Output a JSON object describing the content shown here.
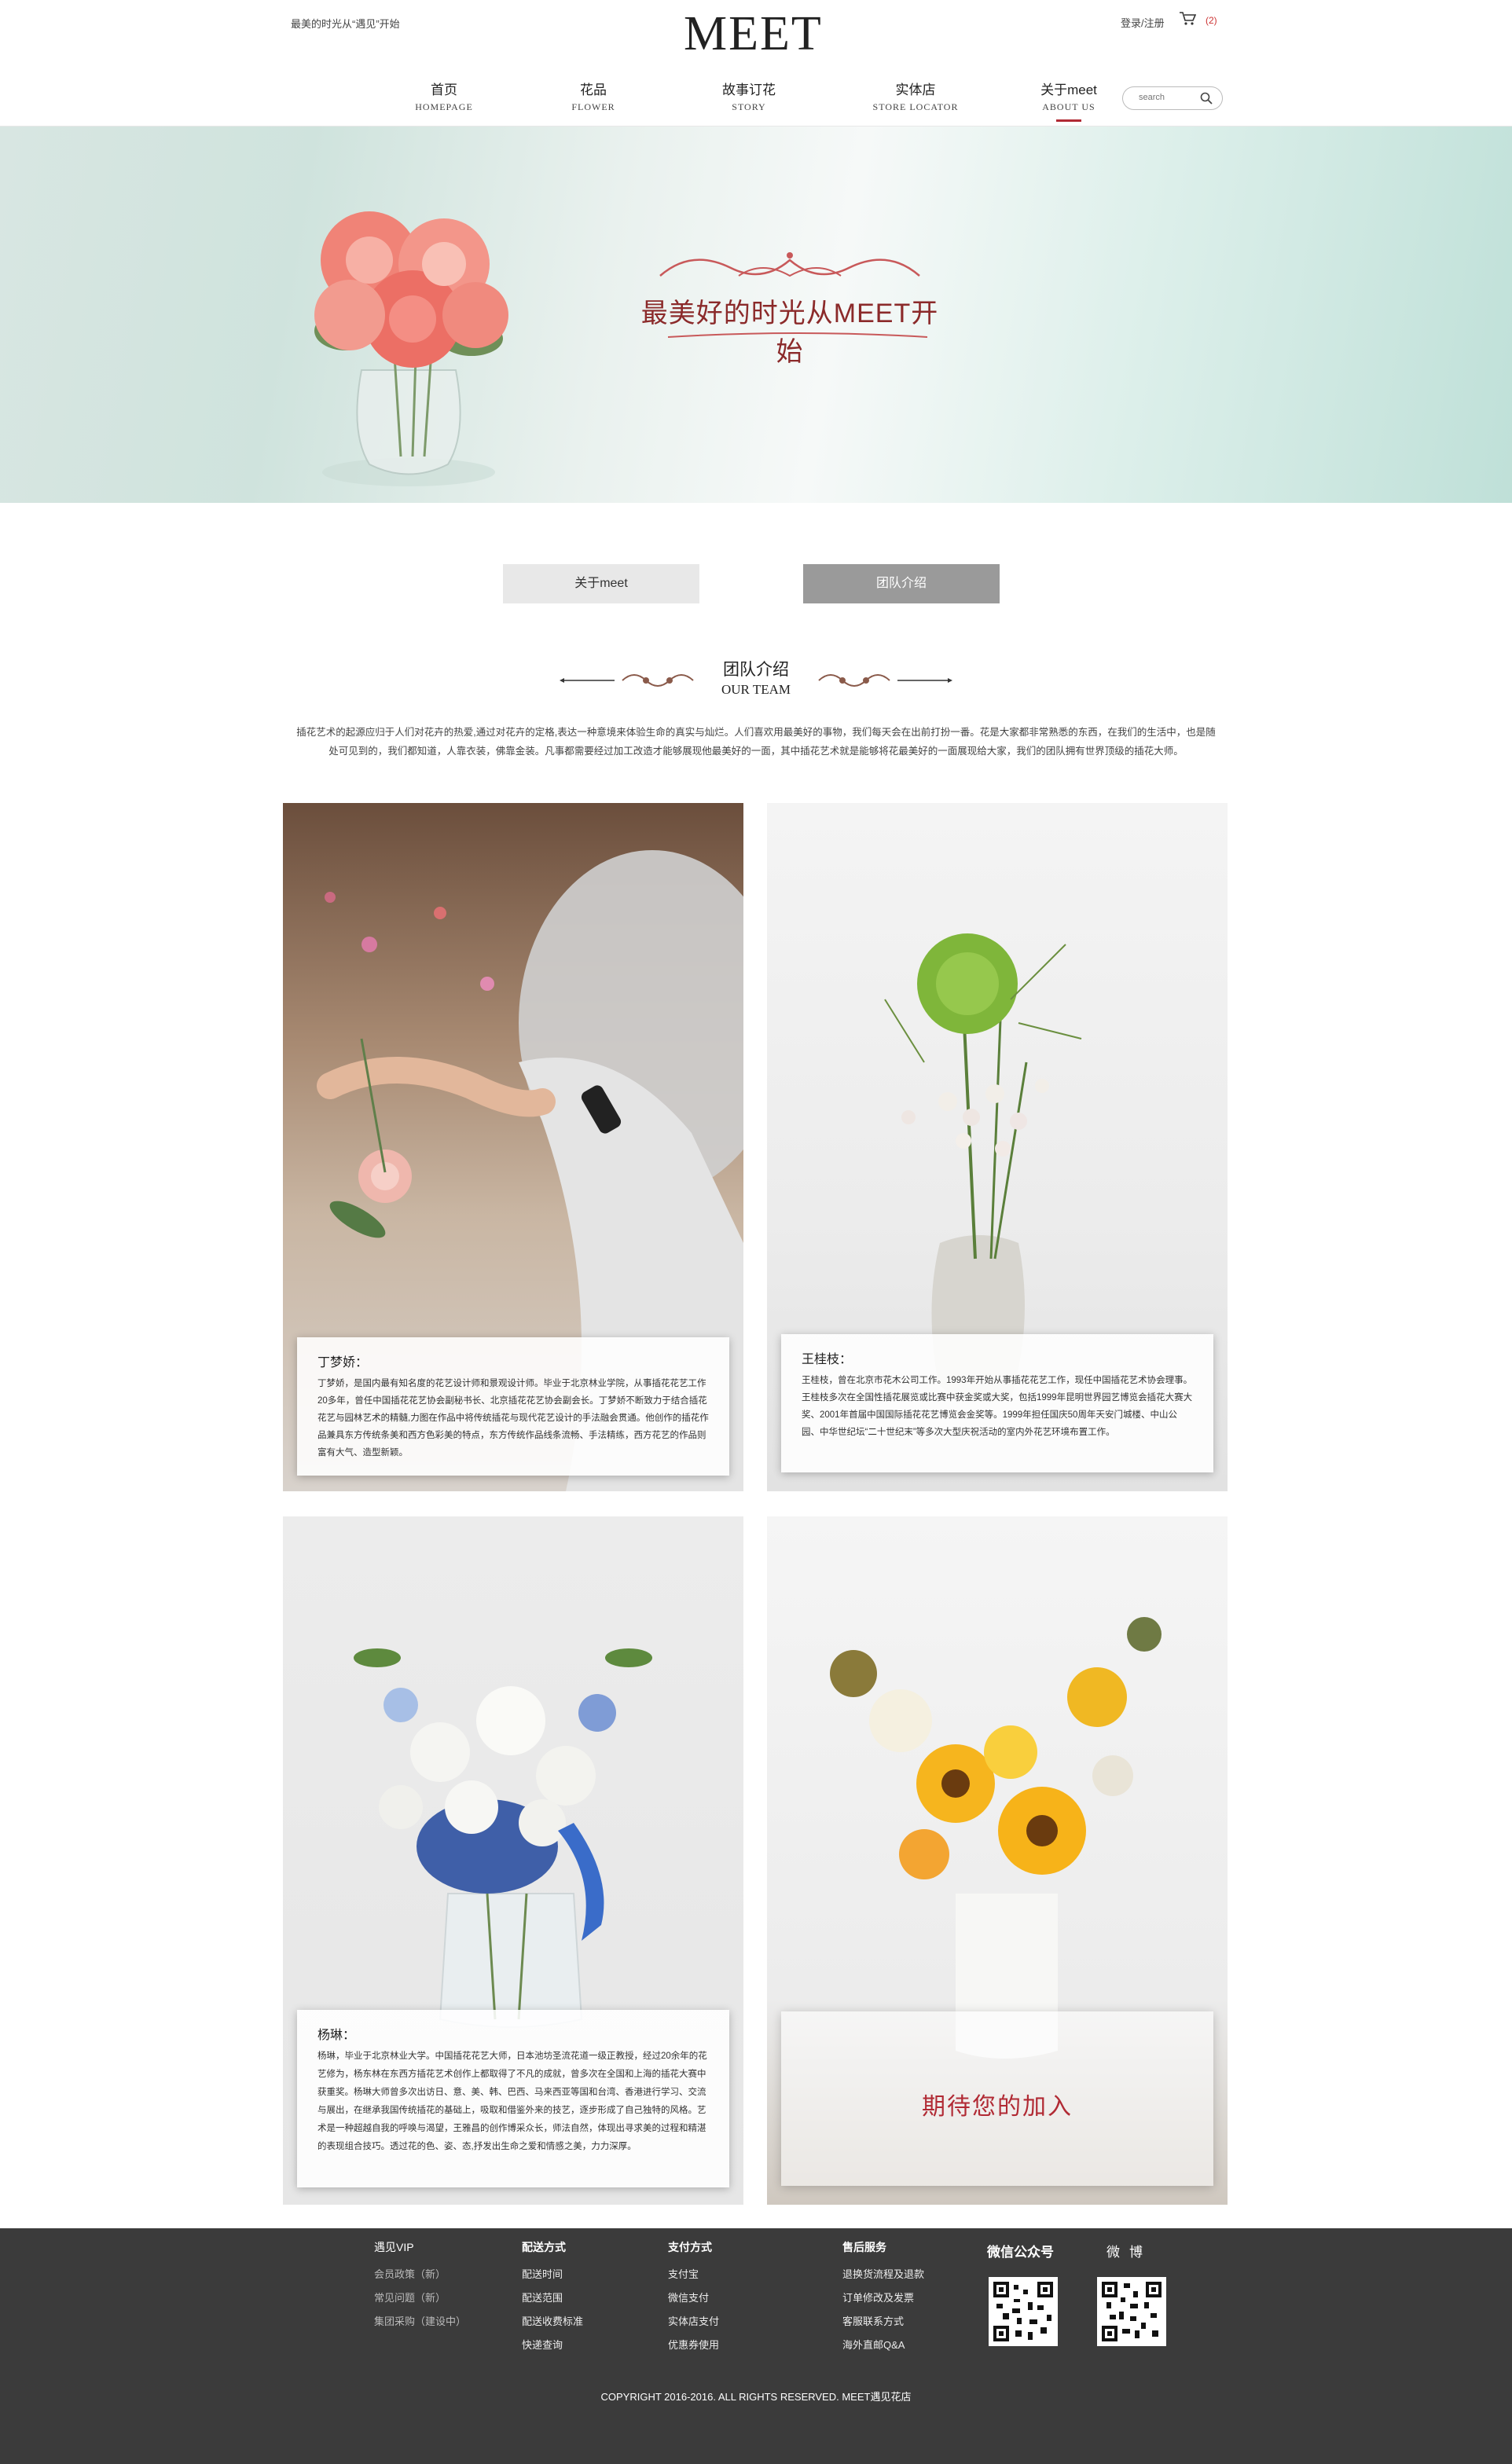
{
  "header": {
    "tagline": "最美的时光从“遇见”开始",
    "logo": "MEET",
    "login": "登录/注册",
    "cart_count": "(2)",
    "search_placeholder": "search",
    "active_color": "#b12a34"
  },
  "nav": [
    {
      "cn": "首页",
      "en": "HOMEPAGE"
    },
    {
      "cn": "花品",
      "en": "FLOWER"
    },
    {
      "cn": "故事订花",
      "en": "STORY"
    },
    {
      "cn": "实体店",
      "en": "STORE LOCATOR"
    },
    {
      "cn": "关于meet",
      "en": "ABOUT US",
      "active": true
    }
  ],
  "banner": {
    "title": "最美好的时光从MEET开始"
  },
  "tabs": {
    "about": "关于meet",
    "team": "团队介绍"
  },
  "section": {
    "title_cn": "团队介绍",
    "title_en": "OUR TEAM",
    "intro": "插花艺术的起源应归于人们对花卉的热爱,通过对花卉的定格,表达一种意境来体验生命的真实与灿烂。人们喜欢用最美好的事物，我们每天会在出前打扮一番。花是大家都非常熟悉的东西，在我们的生活中，也是随处可见到的，我们都知道，人靠衣装，佛靠金装。凡事都需要经过加工改造才能够展现他最美好的一面，其中插花艺术就是能够将花最美好的一面展现给大家，我们的团队拥有世界顶级的插花大师。"
  },
  "team": [
    {
      "name": "丁梦娇：",
      "desc": "丁梦娇，是国内最有知名度的花艺设计师和景观设计师。毕业于北京林业学院，从事插花花艺工作20多年，曾任中国插花花艺协会副秘书长、北京插花花艺协会副会长。丁梦娇不断致力于结合插花花艺与园林艺术的精髓,力图在作品中将传统插花与现代花艺设计的手法融会贯通。他创作的插花作品兼具东方传统条美和西方色彩美的特点，东方传统作品线条流畅、手法精练，西方花艺的作品则富有大气、造型新颖。"
    },
    {
      "name": "王桂枝：",
      "desc": "王桂枝，曾在北京市花木公司工作。1993年开始从事插花花艺工作，现任中国插花艺术协会理事。王桂枝多次在全国性插花展览或比赛中获金奖或大奖，包括1999年昆明世界园艺博览会插花大赛大奖、2001年首届中国国际插花花艺博览会金奖等。1999年担任国庆50周年天安门城楼、中山公园、中华世纪坛“二十世纪末”等多次大型庆祝活动的室内外花艺环境布置工作。"
    },
    {
      "name": "杨琳：",
      "desc": "杨琳，毕业于北京林业大学。中国插花花艺大师，日本池坊圣流花道一级正教授，经过20余年的花艺修为，杨东林在东西方插花艺术创作上都取得了不凡的成就，曾多次在全国和上海的插花大赛中获重奖。杨琳大师曾多次出访日、意、美、韩、巴西、马来西亚等国和台湾、香港进行学习、交流与展出，在继承我国传统插花的基础上，吸取和借鉴外来的技艺，逐步形成了自己独特的风格。艺术是一种超越自我的呼唤与渴望，王雅昌的创作博采众长，师法自然，体现出寻求美的过程和精湛的表现组合技巧。透过花的色、姿、态,抒发出生命之爱和情感之美，力力深厚。"
    }
  ],
  "join": "期待您的加入",
  "footer": {
    "cols": [
      {
        "title": "遇见VIP",
        "items": [
          "会员政策（新）",
          "常见问题（新）",
          "集团采购（建设中）"
        ]
      },
      {
        "title": "配送方式",
        "items": [
          "配送时间",
          "配送范围",
          "配送收费标准",
          "快递查询"
        ]
      },
      {
        "title": "支付方式",
        "items": [
          "支付宝",
          "微信支付",
          "实体店支付",
          "优惠券使用"
        ]
      },
      {
        "title": "售后服务",
        "items": [
          "退换货流程及退款",
          "订单修改及发票",
          "客服联系方式",
          "海外直邮Q&A"
        ]
      }
    ],
    "wechat": "微信公众号",
    "weibo": "微博",
    "copyright": "COPYRIGHT 2016-2016. ALL RIGHTS RESERVED. MEET遇见花店"
  }
}
